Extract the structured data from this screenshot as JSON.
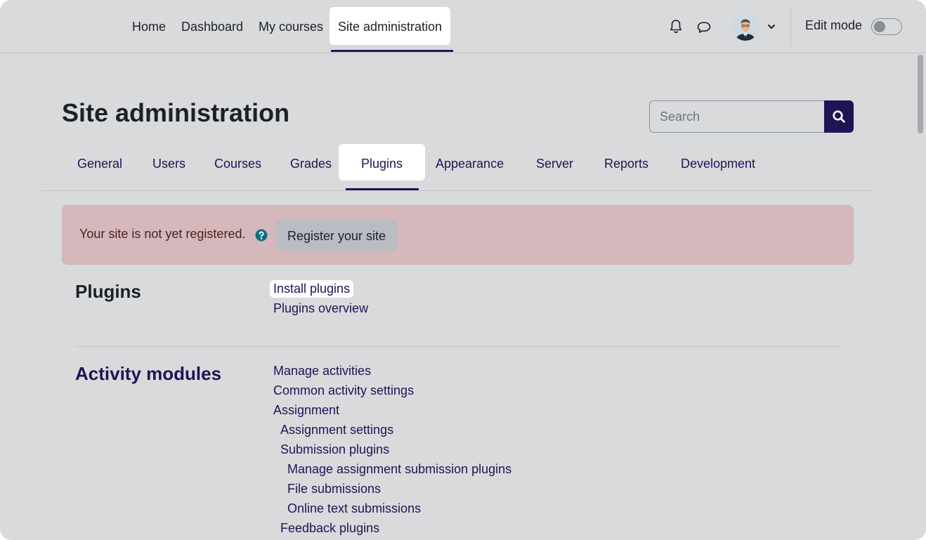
{
  "navbar": {
    "items": [
      {
        "label": "Home"
      },
      {
        "label": "Dashboard"
      },
      {
        "label": "My courses"
      },
      {
        "label": "Site administration",
        "active": true
      }
    ],
    "icons": [
      "bell-icon",
      "chat-icon",
      "avatar",
      "chevron-down-icon"
    ],
    "edit_mode_label": "Edit mode",
    "edit_mode_on": false
  },
  "header": {
    "title": "Site administration",
    "search_placeholder": "Search"
  },
  "tabs": [
    {
      "label": "General"
    },
    {
      "label": "Users"
    },
    {
      "label": "Courses"
    },
    {
      "label": "Grades"
    },
    {
      "label": "Plugins",
      "active": true
    },
    {
      "label": "Appearance"
    },
    {
      "label": "Server"
    },
    {
      "label": "Reports"
    },
    {
      "label": "Development"
    }
  ],
  "alert": {
    "text": "Your site is not yet registered.",
    "button_label": "Register your site"
  },
  "sections": {
    "plugins": {
      "title": "Plugins",
      "links": [
        "Install plugins",
        "Plugins overview"
      ]
    },
    "activity_modules": {
      "title": "Activity modules",
      "links": [
        "Manage activities",
        "Common activity settings",
        "Assignment",
        "Assignment settings",
        "Submission plugins",
        "Manage assignment submission plugins",
        "File submissions",
        "Online text submissions",
        "Feedback plugins"
      ]
    }
  },
  "colors": {
    "background": "#d9dadc",
    "brand": "#1d1554",
    "alert_bg": "#d4b8bb",
    "help_icon": "#0f6e84"
  }
}
